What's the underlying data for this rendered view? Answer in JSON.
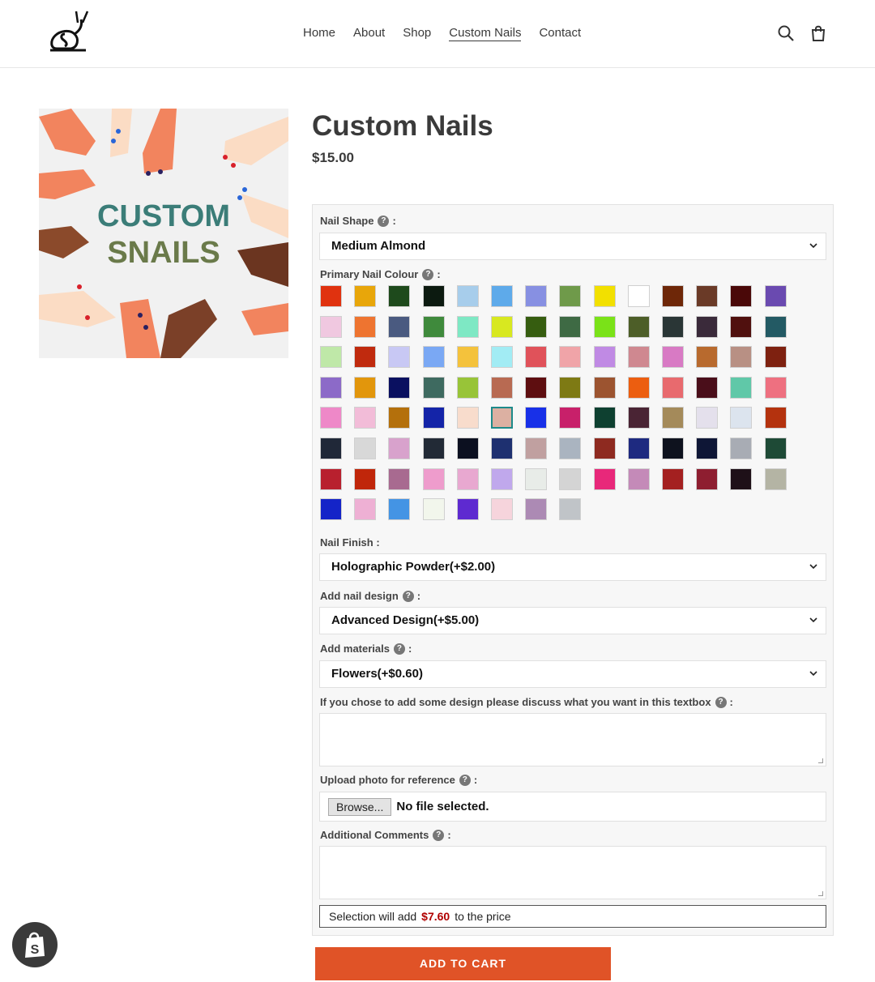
{
  "header": {
    "logo_icon": "snail-logo-icon",
    "nav": [
      "Home",
      "About",
      "Shop",
      "Custom Nails",
      "Contact"
    ],
    "active_nav": "Custom Nails",
    "search_icon": "search-icon",
    "cart_icon": "cart-icon"
  },
  "product": {
    "image_text_line1": "CUSTOM",
    "image_text_line2": "SNAILS",
    "title": "Custom Nails",
    "price": "$15.00"
  },
  "options": {
    "nail_shape": {
      "label": "Nail Shape",
      "value": "Medium Almond"
    },
    "primary_colour": {
      "label": "Primary Nail Colour",
      "selected_index": 61,
      "swatches": [
        "#e0320f",
        "#e8a60a",
        "#1e4a1c",
        "#0c1a10",
        "#a7cdeb",
        "#5eaaea",
        "#8790e2",
        "#6f9a4a",
        "#f2e000",
        "#ffffff",
        "#6e2708",
        "#6a3a27",
        "#4a0808",
        "#6a4ab0",
        "#f0c8e0",
        "#ee7430",
        "#4a5a80",
        "#3f8a3c",
        "#7ee8c4",
        "#d8e820",
        "#365d10",
        "#3e6a44",
        "#7ae218",
        "#4d5e28",
        "#2a3636",
        "#3a2a3a",
        "#50100e",
        "#235a64",
        "#bfe8a8",
        "#c02a0e",
        "#c8c8f4",
        "#7aa8f4",
        "#f4c23c",
        "#a2ecf4",
        "#e0525a",
        "#f0a4a8",
        "#c08ae4",
        "#cf8890",
        "#d87ac4",
        "#b86a2e",
        "#b89084",
        "#7e2110",
        "#8c6ac8",
        "#e2960c",
        "#0a1060",
        "#3e6a60",
        "#98c438",
        "#b86a52",
        "#5e0e10",
        "#7e7a14",
        "#9c5430",
        "#ec5e10",
        "#e86a6e",
        "#4a0e1a",
        "#60c8a8",
        "#ee7080",
        "#ee88c8",
        "#f2bcd8",
        "#b4700c",
        "#1424a8",
        "#f8dccc",
        "#dcb0a2",
        "#1830e8",
        "#c8206a",
        "#0e4030",
        "#4a2434",
        "#a48a5a",
        "#e4e0ec",
        "#dce4ee",
        "#b4320e",
        "#202838",
        "#d8d8d8",
        "#d8a2cc",
        "#222a36",
        "#0c1020",
        "#1e3070",
        "#c0a0a0",
        "#aab4c0",
        "#8e2a20",
        "#1e2a80",
        "#0e121e",
        "#0e1636",
        "#a8acb4",
        "#1e4a36",
        "#b8202e",
        "#c0260a",
        "#a86a90",
        "#ee9ccc",
        "#e8a8d0",
        "#c0a8ec",
        "#e8ece8",
        "#d4d4d4",
        "#e8287a",
        "#c48ab8",
        "#a42020",
        "#8e1e30",
        "#1e1018",
        "#b4b4a4",
        "#1424c8",
        "#eeb0d4",
        "#4494e4",
        "#f2f6ec",
        "#5e2ad0",
        "#f6d4dc",
        "#ac8ab4",
        "#c0c4c8"
      ]
    },
    "nail_finish": {
      "label": "Nail Finish",
      "value": "Holographic Powder(+$2.00)"
    },
    "nail_design": {
      "label": "Add nail design",
      "value": "Advanced Design(+$5.00)"
    },
    "materials": {
      "label": "Add materials",
      "value": "Flowers(+$0.60)"
    },
    "design_text": {
      "label": "If you chose to add some design please discuss what you want in this textbox",
      "value": ""
    },
    "upload": {
      "label": "Upload photo for reference",
      "button": "Browse...",
      "status": "No file selected."
    },
    "comments": {
      "label": "Additional Comments",
      "value": ""
    },
    "summary": {
      "prefix": "Selection will add",
      "amount": "$7.60",
      "suffix": "to the price"
    }
  },
  "cart_button": "ADD TO CART",
  "shopify_badge_icon": "shopify-bag-icon",
  "help_glyph": "?",
  "colors": {
    "accent": "#e05327",
    "selected_swatch_border": "#1d8a8a",
    "price_red": "#b10000"
  }
}
